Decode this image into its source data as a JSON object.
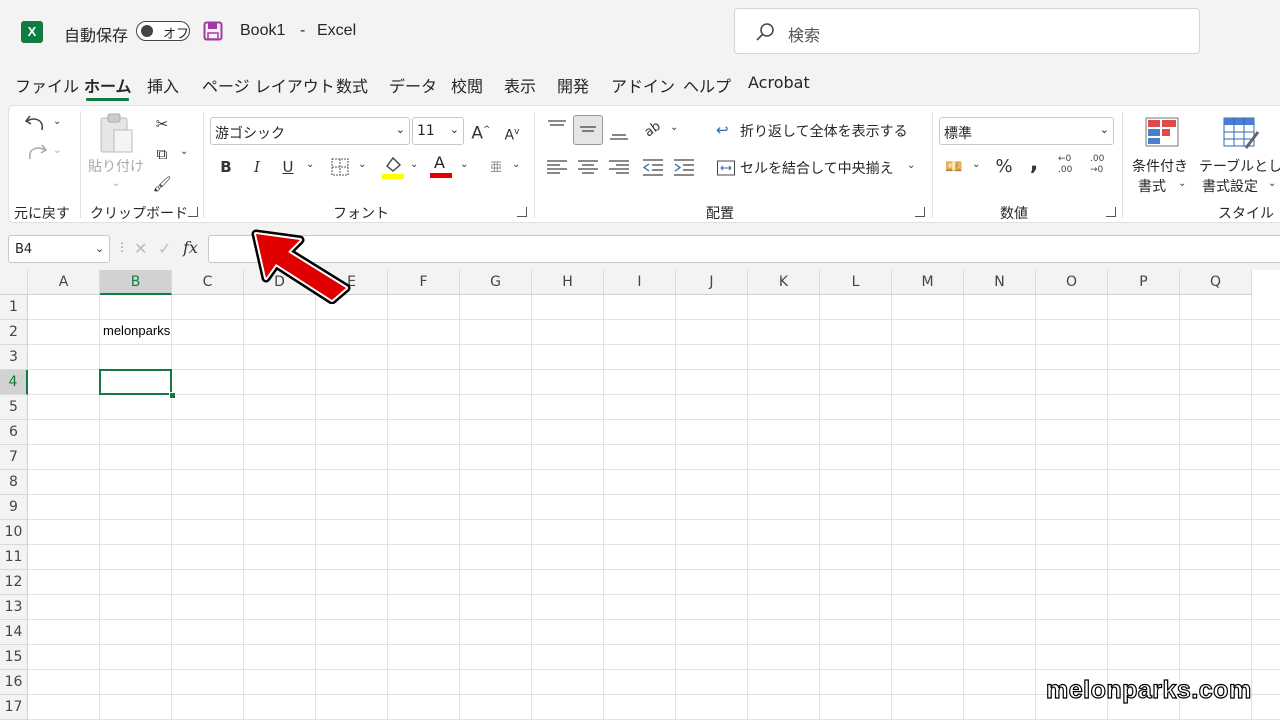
{
  "titlebar": {
    "app_logo": "X",
    "autosave_label": "自動保存",
    "autosave_state": "オフ",
    "book_name": "Book1",
    "separator": "-",
    "app_name": "Excel",
    "search_placeholder": "検索"
  },
  "tabs": [
    "ファイル",
    "ホーム",
    "挿入",
    "ページ レイアウト",
    "数式",
    "データ",
    "校閲",
    "表示",
    "開発",
    "アドイン",
    "ヘルプ",
    "Acrobat"
  ],
  "active_tab": "ホーム",
  "ribbon": {
    "undo_group": "元に戻す",
    "paste_label": "貼り付け",
    "clipboard_group": "クリップボード",
    "font_name": "游ゴシック",
    "font_size": "11",
    "font_group": "フォント",
    "bold": "B",
    "italic": "I",
    "underline": "U",
    "font_color_glyph": "A",
    "wrap_text": "折り返して全体を表示する",
    "merge_center": "セルを結合して中央揃え",
    "alignment_group": "配置",
    "number_format": "標準",
    "percent": "%",
    "comma": ",",
    "number_group": "数値",
    "conditional_format_line1": "条件付き",
    "conditional_format_line2": "書式",
    "table_format_line1": "テーブルとして",
    "table_format_line2": "書式設定",
    "styles_group": "スタイル"
  },
  "formula_bar": {
    "name_box": "B4",
    "fx": "fx",
    "content": ""
  },
  "sheet": {
    "columns": [
      "A",
      "B",
      "C",
      "D",
      "E",
      "F",
      "G",
      "H",
      "I",
      "J",
      "K",
      "L",
      "M",
      "N",
      "O",
      "P",
      "Q"
    ],
    "rows": [
      "1",
      "2",
      "3",
      "4",
      "5",
      "6",
      "7",
      "8",
      "9",
      "10",
      "11",
      "12",
      "13",
      "14",
      "15",
      "16",
      "17"
    ],
    "selected_column": "B",
    "selected_row": "4",
    "cell_B2": "melonparks"
  },
  "watermark": "melonparks.com",
  "colors": {
    "excel_green": "#107c41",
    "arrow_red": "#e00000",
    "font_color_bar": "#e00000",
    "fill_color_bar": "#ffff00"
  }
}
